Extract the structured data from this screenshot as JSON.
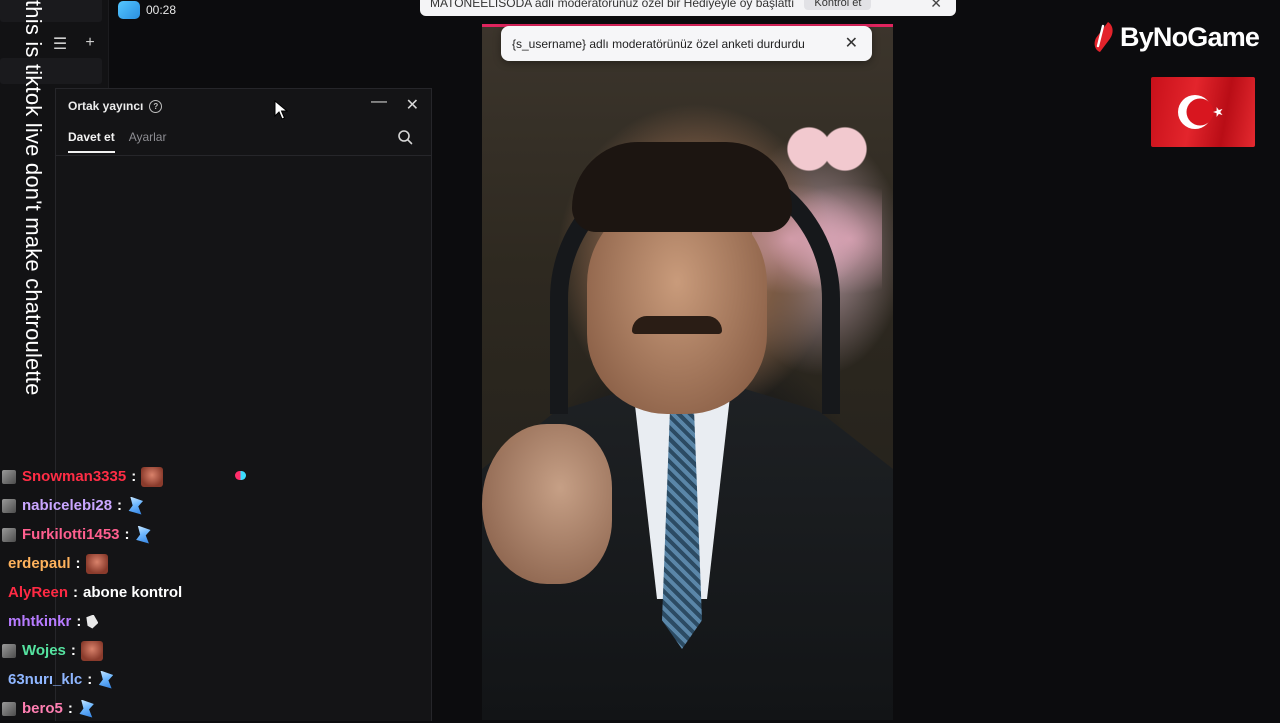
{
  "app": {
    "timer": "00:28",
    "caption": "this is tiktok live don't make chatroulette"
  },
  "cohost_panel": {
    "title": "Ortak yayıncı",
    "tabs": [
      {
        "label": "Davet et",
        "active": true
      },
      {
        "label": "Ayarlar",
        "active": false
      }
    ],
    "icons": {
      "help": "help-circle-icon",
      "minimize": "minimize-icon",
      "close": "close-icon",
      "search": "search-icon"
    }
  },
  "notifications": {
    "top_banner": {
      "text": "MATONEELISODA adlı moderatörünüz özel bir Hediyeyle oy başlattı",
      "button": "Kontrol et"
    },
    "moderator_toast": "{s_username} adlı moderatörünüz özel anketi durdurdu"
  },
  "chat": [
    {
      "user": "Snowman3335",
      "color": "#ff2d45",
      "message": "",
      "emote": "face",
      "avatar": true
    },
    {
      "user": "nabicelebi28",
      "color": "#c9a6ff",
      "message": "",
      "emote": "wing",
      "avatar": true
    },
    {
      "user": "Furkilotti1453",
      "color": "#ff5f8f",
      "message": "",
      "emote": "wing",
      "avatar": true
    },
    {
      "user": "erdepaul",
      "color": "#ffb25c",
      "message": "",
      "emote": "face",
      "avatar": false
    },
    {
      "user": "AlyReen",
      "color": "#ff2a44",
      "message": "abone kontrol",
      "emote": "",
      "avatar": false
    },
    {
      "user": "mhtkinkr",
      "color": "#b77bff",
      "message": "",
      "emote": "small",
      "avatar": false
    },
    {
      "user": "Wojes",
      "color": "#55e3a0",
      "message": "",
      "emote": "face",
      "avatar": true
    },
    {
      "user": "63nurı_klc",
      "color": "#8fb6ff",
      "message": "",
      "emote": "wing",
      "avatar": false
    },
    {
      "user": "bero5",
      "color": "#ff7fb2",
      "message": "",
      "emote": "wing",
      "avatar": true
    }
  ],
  "branding": {
    "name": "ByNoGame",
    "flag": "turkey-flag"
  },
  "colors": {
    "accent": "#e0245e",
    "panel_bg": "#141416",
    "toast_bg": "#f6f6f8"
  }
}
